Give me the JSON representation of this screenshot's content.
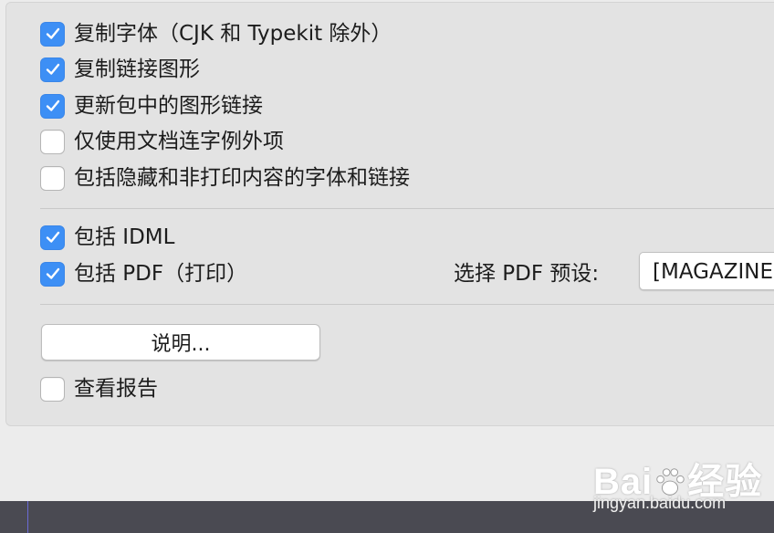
{
  "options_top": [
    {
      "label": "复制字体（CJK 和 Typekit 除外）",
      "checked": true
    },
    {
      "label": "复制链接图形",
      "checked": true
    },
    {
      "label": "更新包中的图形链接",
      "checked": true
    },
    {
      "label": "仅使用文档连字例外项",
      "checked": false
    },
    {
      "label": "包括隐藏和非打印内容的字体和链接",
      "checked": false
    }
  ],
  "options_mid": [
    {
      "label": "包括 IDML",
      "checked": true
    },
    {
      "label": "包括 PDF（打印）",
      "checked": true
    }
  ],
  "pdf_preset": {
    "label": "选择 PDF 预设:",
    "value": "[MAGAZINE"
  },
  "instructions_button": "说明...",
  "view_report": {
    "label": "查看报告",
    "checked": false
  },
  "watermark": {
    "logo_left": "Bai",
    "logo_right": "经验",
    "url": "jingyan.baidu.com"
  },
  "colors": {
    "checkbox_on": "#3d8ff5",
    "panel": "#e3e3e3",
    "dialog": "#ececec"
  }
}
